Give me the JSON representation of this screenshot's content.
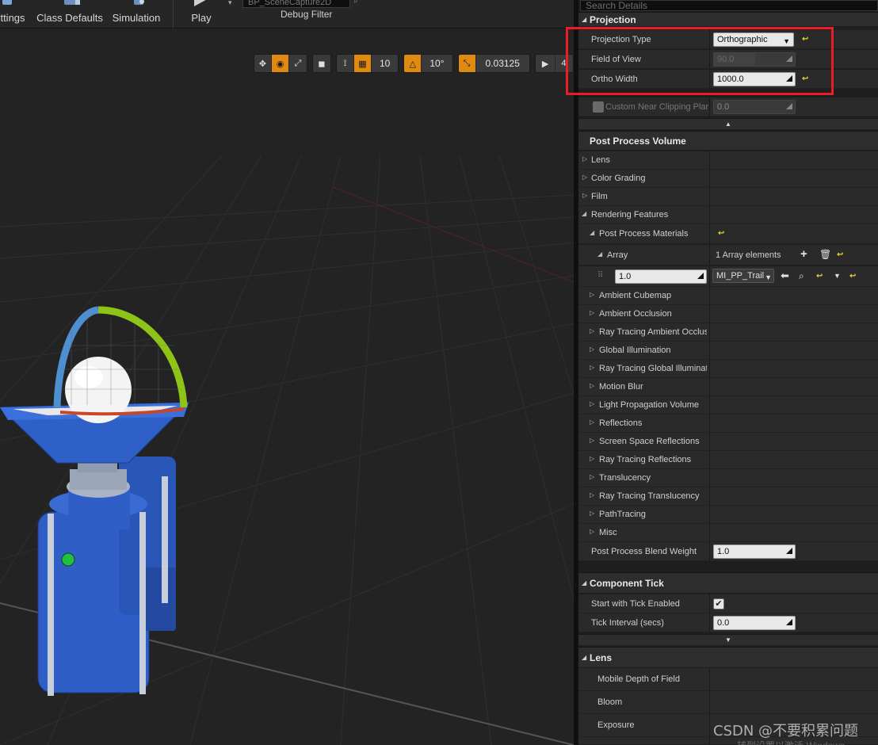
{
  "toolbar": {
    "settings_label": "ttings",
    "class_defaults_label": "Class Defaults",
    "simulation_label": "Simulation",
    "play_label": "Play",
    "debug_filter_value": "BP_SceneCapture2D",
    "debug_filter_label": "Debug Filter"
  },
  "viewport_tools": {
    "grid_snap": "10",
    "rotation_snap": "10°",
    "scale_snap": "0.03125",
    "camera_speed": "4"
  },
  "details": {
    "search_placeholder": "Search Details",
    "projection": {
      "header": "Projection",
      "projection_type_label": "Projection Type",
      "projection_type_value": "Orthographic",
      "fov_label": "Field of View",
      "fov_value": "90.0",
      "ortho_width_label": "Ortho Width",
      "ortho_width_value": "1000.0",
      "custom_near_label": "Custom Near Clipping Plane",
      "custom_near_value": "0.0"
    },
    "post_process": {
      "header": "Post Process Volume",
      "items": [
        "Lens",
        "Color Grading",
        "Film",
        "Rendering Features"
      ],
      "materials_label": "Post Process Materials",
      "array_label": "Array",
      "array_count": "1 Array elements",
      "element_weight": "1.0",
      "element_material": "MI_PP_Trail",
      "sub_items": [
        "Ambient Cubemap",
        "Ambient Occlusion",
        "Ray Tracing Ambient Occlusion",
        "Global Illumination",
        "Ray Tracing Global Illumination",
        "Motion Blur",
        "Light Propagation Volume",
        "Reflections",
        "Screen Space Reflections",
        "Ray Tracing Reflections",
        "Translucency",
        "Ray Tracing Translucency",
        "PathTracing",
        "Misc"
      ],
      "blend_weight_label": "Post Process Blend Weight",
      "blend_weight_value": "1.0"
    },
    "component_tick": {
      "header": "Component Tick",
      "start_label": "Start with Tick Enabled",
      "interval_label": "Tick Interval (secs)",
      "interval_value": "0.0"
    },
    "lens": {
      "header": "Lens",
      "items": [
        "Mobile Depth of Field",
        "Bloom",
        "Exposure"
      ]
    }
  },
  "watermark": "CSDN @不要积累问题",
  "watermark_sub": "转到设置以激活 Windows",
  "colors": {
    "accent_orange": "#e08a12",
    "highlight_red": "#e81d25",
    "reset_yellow": "#e8d63a",
    "model_blue": "#2f5fc4"
  }
}
